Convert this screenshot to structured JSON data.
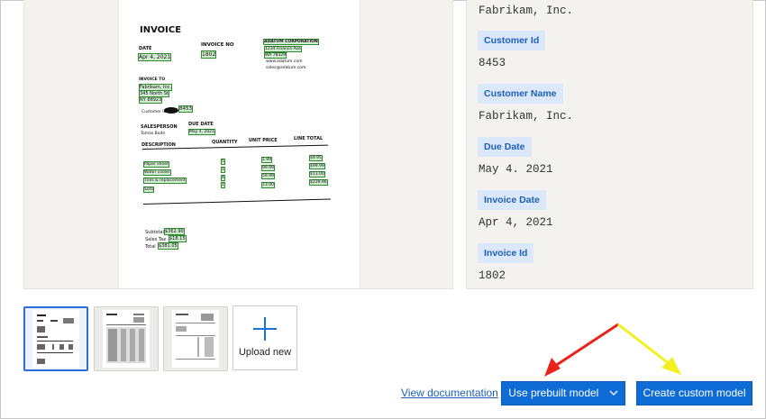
{
  "invoice_preview": {
    "title": "INVOICE",
    "date_label": "DATE",
    "date_value": "Apr 4, 2021",
    "invoice_no_label": "INVOICE NO",
    "invoice_no_value": "1802",
    "vendor_name": "ADATUM CORPORATION",
    "vendor_address_1": "1234 Finance Ave",
    "vendor_address_2": "WA 78329",
    "vendor_web": "www.adatum.com",
    "vendor_email": "sales@adatum.com",
    "invoice_to_label": "INVOICE TO",
    "customer_name": "Fabrikam, Inc.",
    "customer_address_1": "345 North St",
    "customer_address_2": "NY 88923",
    "customer_id_label": "Customer ID:",
    "customer_id_value": "8453",
    "salesperson_label": "SALESPERSON",
    "salesperson_value": "Tomas Bode",
    "due_date_label": "DUE DATE",
    "due_date_value": "May 4, 2021",
    "col_description": "DESCRIPTION",
    "col_quantity": "QUANTITY",
    "col_unit_price": "UNIT PRICE",
    "col_line_total": "LINE TOTAL",
    "items": [
      {
        "desc": "Paper sheet",
        "qty": "5",
        "price": "1.99",
        "total": "$9.95"
      },
      {
        "desc": "Water cooler",
        "qty": "1",
        "price": "99.99",
        "total": "$99.99"
      },
      {
        "desc": "Tires & replacement",
        "qty": "4",
        "price": "59.99",
        "total": "$239.96"
      },
      {
        "desc": "Sofa",
        "qty": "1",
        "price": "13.00",
        "total": "$13.00"
      }
    ],
    "subtotal_label": "Subtotal",
    "subtotal_value": "$362.90",
    "tax_label": "Sales Tax",
    "tax_value": "$18.15",
    "total_label": "Total",
    "total_value": "$381.05"
  },
  "fields": {
    "top_value": "Fabrikam, Inc.",
    "items": [
      {
        "label": "Customer Id",
        "value": "8453"
      },
      {
        "label": "Customer Name",
        "value": "Fabrikam, Inc."
      },
      {
        "label": "Due Date",
        "value": "May 4. 2021"
      },
      {
        "label": "Invoice Date",
        "value": "Apr 4, 2021"
      },
      {
        "label": "Invoice Id",
        "value": "1802"
      }
    ]
  },
  "thumbnails": {
    "upload_label": "Upload new"
  },
  "footer": {
    "view_docs": "View documentation",
    "prebuilt_label": "Use prebuilt model",
    "custom_label": "Create custom model"
  },
  "colors": {
    "accent": "#0f6cd6",
    "badge_bg": "#dbe8fa",
    "highlight_green": "#2e8b2e",
    "arrow_red": "#e8231c",
    "arrow_yellow": "#f2f01e"
  },
  "icons": {
    "upload": "plus-icon",
    "dropdown": "chevron-down-icon"
  }
}
